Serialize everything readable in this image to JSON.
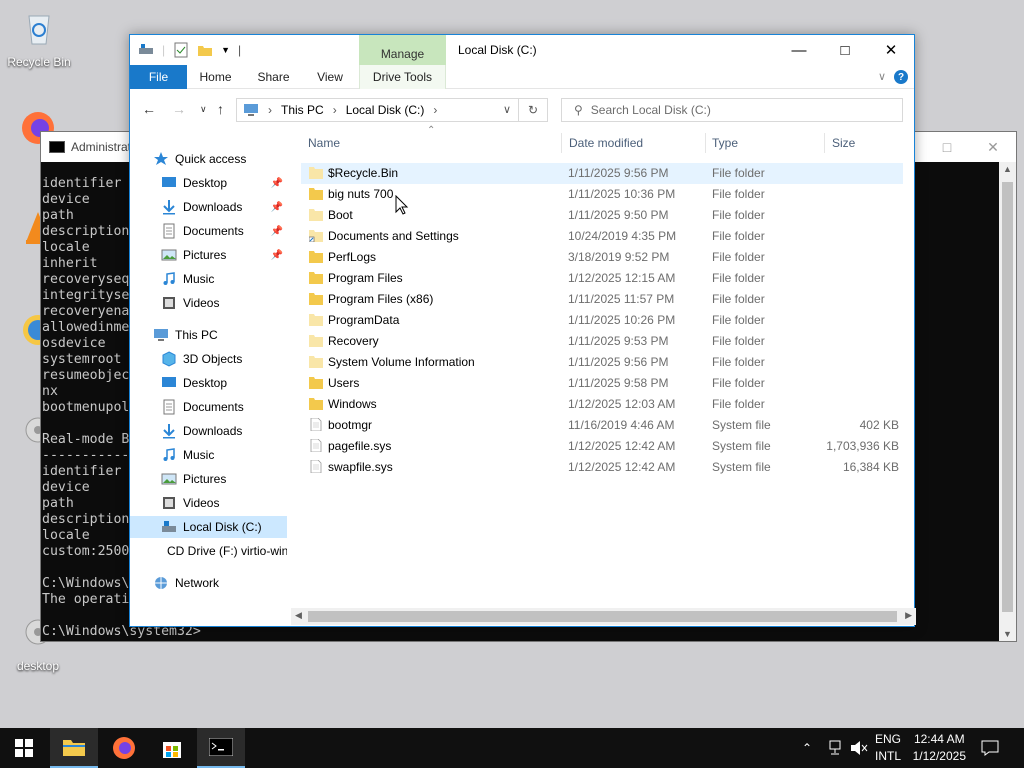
{
  "desktop": {
    "icons": [
      {
        "label": "Recycle Bin"
      },
      {
        "label": "Firefox"
      },
      {
        "label": "VLC media player"
      },
      {
        "label": "WinaeroTweaker"
      },
      {
        "label": "desktop"
      },
      {
        "label": "desktop"
      }
    ]
  },
  "cmd": {
    "title": "Administrator: Command Prompt",
    "lines": [
      "identifier              {bootmgr}",
      "device                  partition=C:",
      "path                    \\bootmgr",
      "description             Windows Boot Manager",
      "locale                  en-US",
      "inherit                 {globalsettings}",
      "recoverysequence        {...}",
      "integrityservices       Enable",
      "recoveryenabled         Yes",
      "allowedinmemorysettings 0x15000075",
      "osdevice                partition=C:",
      "systemroot              \\Windows",
      "resumeobject            {...}",
      "nx                      OptIn",
      "bootmenupolicy          Standard",
      "",
      "Real-mode Boot Sector",
      "---------------------",
      "identifier              {...}",
      "device                  partition=C:",
      "path                    \\...",
      "description             ...",
      "locale                  en-US",
      "custom:250000c2         1",
      "",
      "C:\\Windows\\system32>",
      "The operation completed successfully.",
      "",
      "C:\\Windows\\system32>"
    ]
  },
  "explorer": {
    "title": "Local Disk (C:)",
    "manage_tab": "Manage",
    "ribbon_tabs": {
      "file": "File",
      "home": "Home",
      "share": "Share",
      "view": "View",
      "drive_tools": "Drive Tools"
    },
    "breadcrumb": {
      "this_pc": "This PC",
      "local_disk": "Local Disk (C:)"
    },
    "search_placeholder": "Search Local Disk (C:)",
    "nav": {
      "quick_access": "Quick access",
      "qa_desktop": "Desktop",
      "qa_downloads": "Downloads",
      "qa_documents": "Documents",
      "qa_pictures": "Pictures",
      "qa_music": "Music",
      "qa_videos": "Videos",
      "this_pc": "This PC",
      "pc_3d": "3D Objects",
      "pc_desktop": "Desktop",
      "pc_documents": "Documents",
      "pc_downloads": "Downloads",
      "pc_music": "Music",
      "pc_pictures": "Pictures",
      "pc_videos": "Videos",
      "local_disk": "Local Disk (C:)",
      "cd_drive": "CD Drive (F:) virtio-win",
      "network": "Network"
    },
    "columns": {
      "name": "Name",
      "date": "Date modified",
      "type": "Type",
      "size": "Size"
    },
    "files": [
      {
        "name": "$Recycle.Bin",
        "date": "1/11/2025 9:56 PM",
        "type": "File folder",
        "size": "",
        "kind": "folder-faded"
      },
      {
        "name": "big nuts 700",
        "date": "1/11/2025 10:36 PM",
        "type": "File folder",
        "size": "",
        "kind": "folder"
      },
      {
        "name": "Boot",
        "date": "1/11/2025 9:50 PM",
        "type": "File folder",
        "size": "",
        "kind": "folder-faded"
      },
      {
        "name": "Documents and Settings",
        "date": "10/24/2019 4:35 PM",
        "type": "File folder",
        "size": "",
        "kind": "folder-link"
      },
      {
        "name": "PerfLogs",
        "date": "3/18/2019 9:52 PM",
        "type": "File folder",
        "size": "",
        "kind": "folder"
      },
      {
        "name": "Program Files",
        "date": "1/12/2025 12:15 AM",
        "type": "File folder",
        "size": "",
        "kind": "folder"
      },
      {
        "name": "Program Files (x86)",
        "date": "1/11/2025 11:57 PM",
        "type": "File folder",
        "size": "",
        "kind": "folder"
      },
      {
        "name": "ProgramData",
        "date": "1/11/2025 10:26 PM",
        "type": "File folder",
        "size": "",
        "kind": "folder-faded"
      },
      {
        "name": "Recovery",
        "date": "1/11/2025 9:53 PM",
        "type": "File folder",
        "size": "",
        "kind": "folder-faded"
      },
      {
        "name": "System Volume Information",
        "date": "1/11/2025 9:56 PM",
        "type": "File folder",
        "size": "",
        "kind": "folder-faded"
      },
      {
        "name": "Users",
        "date": "1/11/2025 9:58 PM",
        "type": "File folder",
        "size": "",
        "kind": "folder"
      },
      {
        "name": "Windows",
        "date": "1/12/2025 12:03 AM",
        "type": "File folder",
        "size": "",
        "kind": "folder"
      },
      {
        "name": "bootmgr",
        "date": "11/16/2019 4:46 AM",
        "type": "System file",
        "size": "402 KB",
        "kind": "file"
      },
      {
        "name": "pagefile.sys",
        "date": "1/12/2025 12:42 AM",
        "type": "System file",
        "size": "1,703,936 KB",
        "kind": "file"
      },
      {
        "name": "swapfile.sys",
        "date": "1/12/2025 12:42 AM",
        "type": "System file",
        "size": "16,384 KB",
        "kind": "file"
      }
    ]
  },
  "taskbar": {
    "lang_top": "ENG",
    "lang_bottom": "INTL",
    "time": "12:44 AM",
    "date": "1/12/2025"
  },
  "colors": {
    "accent": "#1979ca",
    "selection": "#cce8ff",
    "manage": "#c8e6bd",
    "folder": "#f3c94c"
  }
}
